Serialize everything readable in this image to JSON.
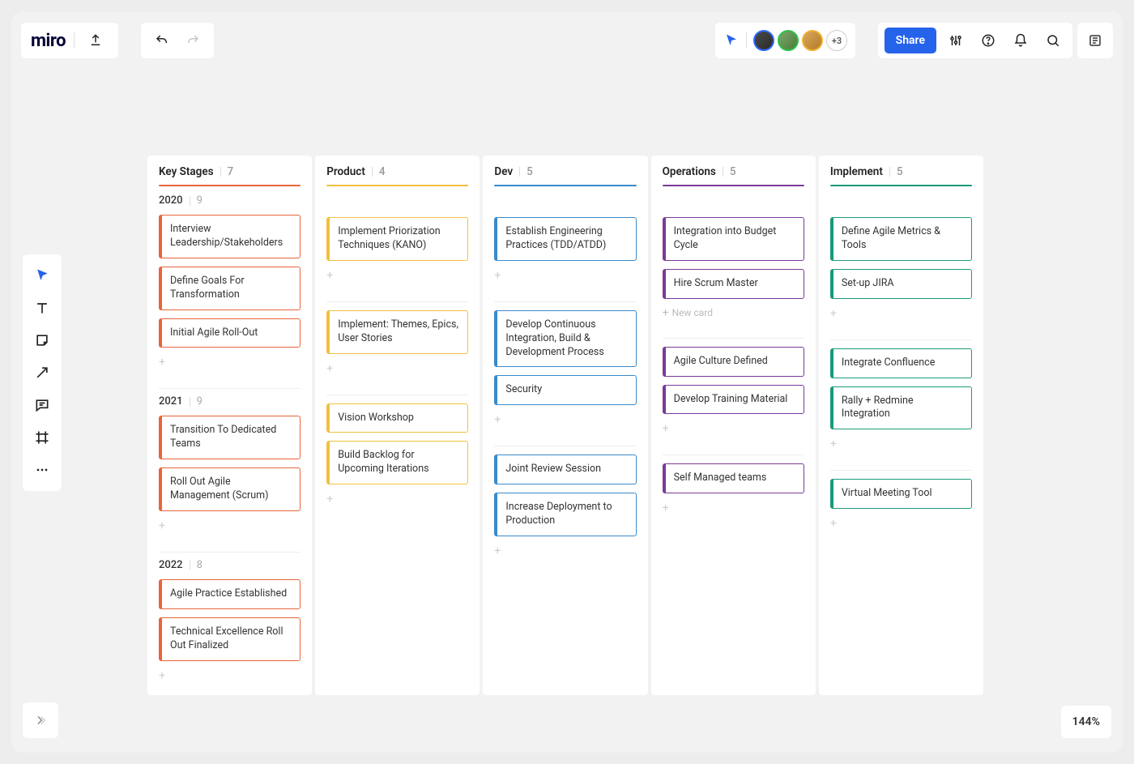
{
  "app_logo": "miro",
  "header": {
    "share_label": "Share",
    "more_count": "+3"
  },
  "zoom": "144%",
  "new_card_label": "New card",
  "columns": [
    {
      "title": "Key Stages",
      "count": 7,
      "color": "orange"
    },
    {
      "title": "Product",
      "count": 4,
      "color": "yellow"
    },
    {
      "title": "Dev",
      "count": 5,
      "color": "blue"
    },
    {
      "title": "Operations",
      "count": 5,
      "color": "purple"
    },
    {
      "title": "Implement",
      "count": 5,
      "color": "teal"
    }
  ],
  "rows": [
    {
      "year": "2020",
      "count": 9
    },
    {
      "year": "2021",
      "count": 9
    },
    {
      "year": "2022",
      "count": 8
    }
  ],
  "cards": {
    "2020": {
      "Key Stages": [
        "Interview Leadership/Stakeholders",
        "Define Goals For Transformation",
        "Initial Agile Roll-Out"
      ],
      "Product": [
        "Implement Priorization Techniques (KANO)"
      ],
      "Dev": [
        "Establish Engineering Practices (TDD/ATDD)"
      ],
      "Operations": [
        "Integration into Budget Cycle",
        "Hire Scrum Master"
      ],
      "Implement": [
        "Define Agile Metrics & Tools",
        "Set-up JIRA"
      ]
    },
    "2021": {
      "Key Stages": [
        "Transition To Dedicated Teams",
        "Roll Out Agile Management (Scrum)"
      ],
      "Product": [
        "Implement: Themes, Epics, User Stories"
      ],
      "Dev": [
        "Develop Continuous Integration, Build & Development Process",
        "Security"
      ],
      "Operations": [
        "Agile Culture Defined",
        "Develop Training Material"
      ],
      "Implement": [
        "Integrate Confluence",
        "Rally + Redmine Integration"
      ]
    },
    "2022": {
      "Key Stages": [
        "Agile Practice Established",
        "Technical Excellence Roll Out Finalized"
      ],
      "Product": [
        "Vision Workshop",
        "Build Backlog for Upcoming Iterations"
      ],
      "Dev": [
        "Joint Review Session",
        "Increase Deployment to Production"
      ],
      "Operations": [
        "Self Managed teams"
      ],
      "Implement": [
        "Virtual Meeting Tool"
      ]
    }
  },
  "show_new_card_hint": {
    "row": "2020",
    "col": "Operations"
  }
}
